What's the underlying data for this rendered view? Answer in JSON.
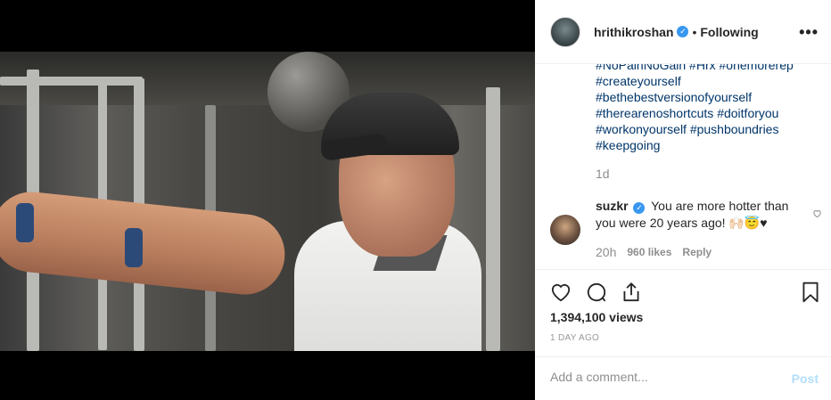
{
  "post": {
    "username": "hrithikroshan",
    "separator": "•",
    "following_label": "Following",
    "more_label": "•••"
  },
  "caption": {
    "lines": [
      "#NoPainNoGain #Hrx #onemorerep",
      "#createyourself",
      "#bethebestversionofyourself",
      "#therearenoshortcuts #doitforyou",
      "#workonyourself #pushboundries",
      "#keepgoing"
    ],
    "time": "1d"
  },
  "comment": {
    "username": "suzkr",
    "text": "You are more hotter than you were 20 years ago! 🙌🏻😇♥",
    "time": "20h",
    "likes": "960 likes",
    "reply_label": "Reply"
  },
  "actions": {
    "views": "1,394,100 views",
    "date": "1 DAY AGO"
  },
  "add_comment": {
    "placeholder": "Add a comment...",
    "post_label": "Post"
  },
  "colors": {
    "link": "#003569",
    "verified": "#3897f0",
    "post_disabled": "#b2dffc"
  },
  "icons": [
    "heart-icon",
    "comment-icon",
    "share-icon",
    "bookmark-icon",
    "verified-icon",
    "more-icon"
  ]
}
